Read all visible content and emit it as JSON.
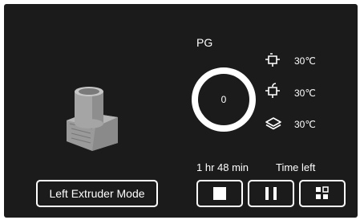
{
  "material": "PG",
  "progress": {
    "value": "0",
    "fraction": 0.0
  },
  "temperatures": [
    {
      "icon": "left-nozzle-icon",
      "value": "30℃"
    },
    {
      "icon": "right-nozzle-icon",
      "value": "30℃"
    },
    {
      "icon": "bed-layers-icon",
      "value": "30℃"
    }
  ],
  "time": {
    "remaining": "1 hr 48 min",
    "label": "Time left"
  },
  "mode_button": "Left Extruder Mode",
  "controls": [
    "stop-icon",
    "pause-icon",
    "more-icon"
  ],
  "colors": {
    "background": "#1b1b1b",
    "foreground": "#ffffff",
    "model": "#a9a9a9"
  }
}
